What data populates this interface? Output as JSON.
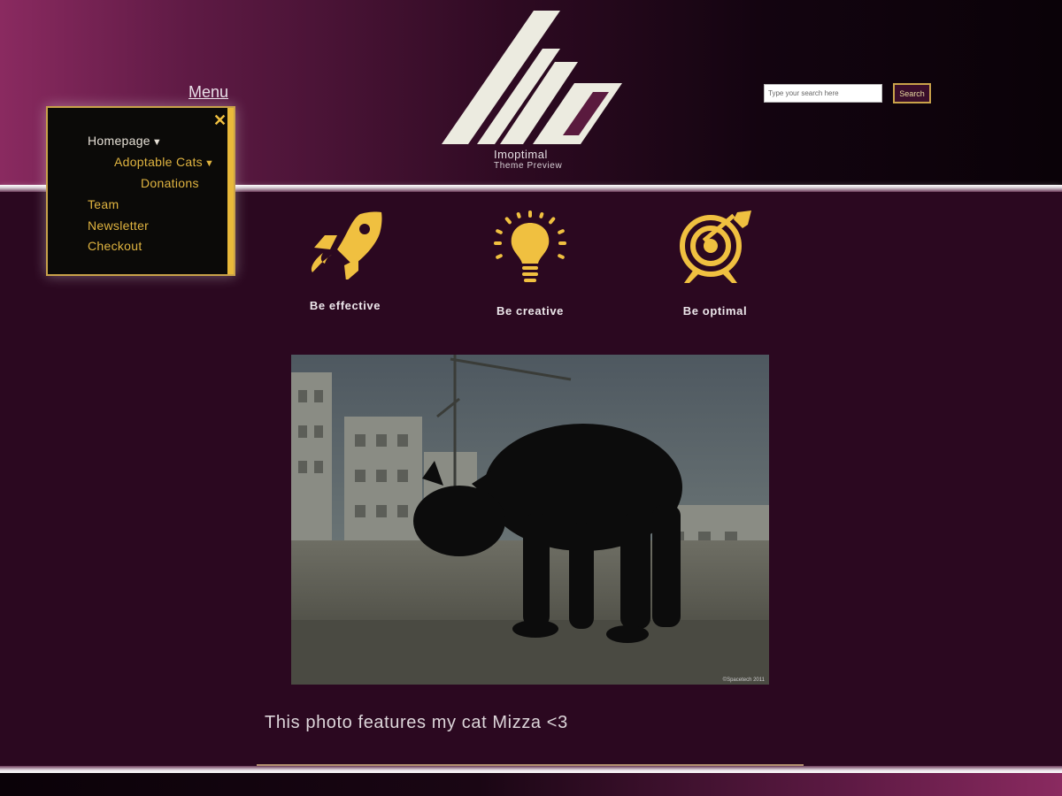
{
  "header": {
    "menu_label": "Menu",
    "site_title": "Imoptimal",
    "site_subtitle": "Theme Preview",
    "logo_icon": "imo-logo-icon"
  },
  "menu": {
    "close_icon": "close-icon",
    "items": [
      {
        "label": "Homepage",
        "has_submenu": true
      },
      {
        "label": "Adoptable Cats",
        "has_submenu": true
      },
      {
        "label": "Donations",
        "has_submenu": false
      },
      {
        "label": "Team",
        "has_submenu": false
      },
      {
        "label": "Newsletter",
        "has_submenu": false
      },
      {
        "label": "Checkout",
        "has_submenu": false
      }
    ],
    "submenu_arrow": "▼"
  },
  "search": {
    "placeholder": "Type your search here",
    "button_label": "Search"
  },
  "features": [
    {
      "label": "Be effective",
      "icon": "rocket-icon"
    },
    {
      "label": "Be creative",
      "icon": "lightbulb-icon"
    },
    {
      "label": "Be optimal",
      "icon": "target-icon"
    }
  ],
  "content": {
    "photo_watermark": "©Spacetech 2011",
    "caption": "This photo features my cat Mizza <3"
  },
  "colors": {
    "accent": "#e9b93a",
    "background": "#2b0820",
    "header_gradient_start": "#8a2a60",
    "header_gradient_end": "#0a0208"
  }
}
